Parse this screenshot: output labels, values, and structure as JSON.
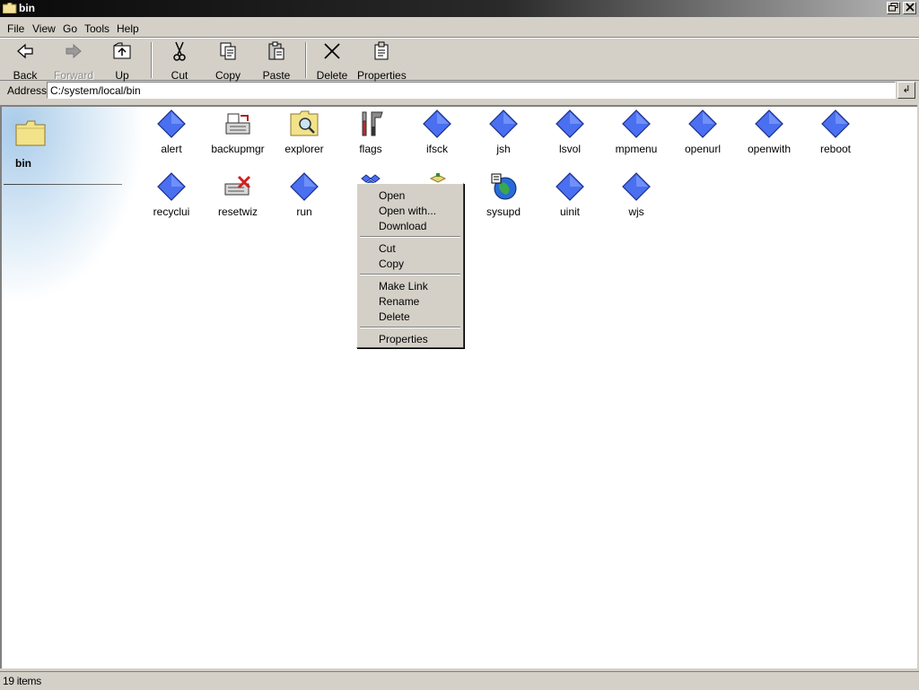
{
  "window": {
    "title": "bin"
  },
  "menubar": [
    "File",
    "View",
    "Go",
    "Tools",
    "Help"
  ],
  "toolbar": {
    "back": "Back",
    "forward": "Forward",
    "up": "Up",
    "cut": "Cut",
    "copy": "Copy",
    "paste": "Paste",
    "delete": "Delete",
    "properties": "Properties"
  },
  "address": {
    "label": "Address",
    "value": "C:/system/local/bin"
  },
  "side": {
    "title": "bin"
  },
  "files": [
    {
      "name": "alert",
      "icon": "diamond-icon"
    },
    {
      "name": "backupmgr",
      "icon": "backup-icon"
    },
    {
      "name": "explorer",
      "icon": "explorer-icon"
    },
    {
      "name": "flags",
      "icon": "tools-icon"
    },
    {
      "name": "ifsck",
      "icon": "diamond-icon"
    },
    {
      "name": "jsh",
      "icon": "diamond-icon"
    },
    {
      "name": "lsvol",
      "icon": "diamond-icon"
    },
    {
      "name": "mpmenu",
      "icon": "diamond-icon"
    },
    {
      "name": "openurl",
      "icon": "diamond-icon"
    },
    {
      "name": "openwith",
      "icon": "diamond-icon"
    },
    {
      "name": "reboot",
      "icon": "diamond-icon"
    },
    {
      "name": "recyclui",
      "icon": "diamond-icon"
    },
    {
      "name": "resetwiz",
      "icon": "reset-icon"
    },
    {
      "name": "run",
      "icon": "diamond-icon"
    },
    {
      "name": "",
      "icon": "blocks-icon"
    },
    {
      "name": "",
      "icon": "package-icon"
    },
    {
      "name": "sysupd",
      "icon": "globe-icon"
    },
    {
      "name": "uinit",
      "icon": "diamond-icon"
    },
    {
      "name": "wjs",
      "icon": "diamond-icon"
    }
  ],
  "context_menu": {
    "open": "Open",
    "open_with": "Open with...",
    "download": "Download",
    "cut": "Cut",
    "copy": "Copy",
    "make_link": "Make Link",
    "rename": "Rename",
    "delete": "Delete",
    "properties": "Properties"
  },
  "status": {
    "text": "19 items"
  },
  "colors": {
    "diamond": "#4a6ff0",
    "diamond_light": "#8aa6ff",
    "chrome": "#d4d0c8"
  }
}
